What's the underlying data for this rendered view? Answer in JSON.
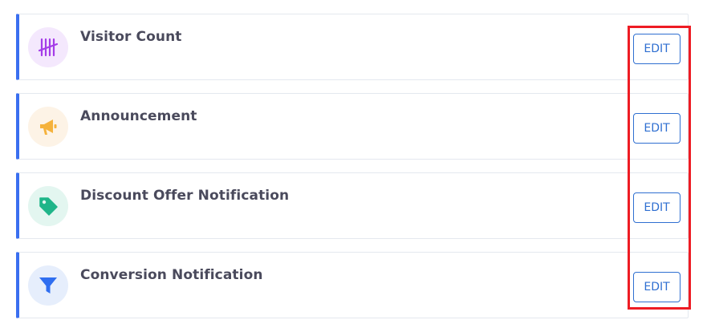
{
  "colors": {
    "accent_border": "#3a6ff0",
    "edit_button": "#2f6fd1",
    "highlight": "#ee1c24",
    "title_text": "#4a4a5c"
  },
  "cards": [
    {
      "title": "Visitor Count",
      "icon": "tally-marks-icon",
      "icon_color": "#a43ce8",
      "icon_bg": "#f4e8fd",
      "edit_label": "EDIT"
    },
    {
      "title": "Announcement",
      "icon": "megaphone-icon",
      "icon_color": "#f5b23c",
      "icon_bg": "#fdf3e6",
      "edit_label": "EDIT"
    },
    {
      "title": "Discount Offer Notification",
      "icon": "price-tag-icon",
      "icon_color": "#1fb589",
      "icon_bg": "#e3f6f0",
      "edit_label": "EDIT"
    },
    {
      "title": "Conversion Notification",
      "icon": "funnel-icon",
      "icon_color": "#2f6ef0",
      "icon_bg": "#e6eefc",
      "edit_label": "EDIT"
    }
  ]
}
